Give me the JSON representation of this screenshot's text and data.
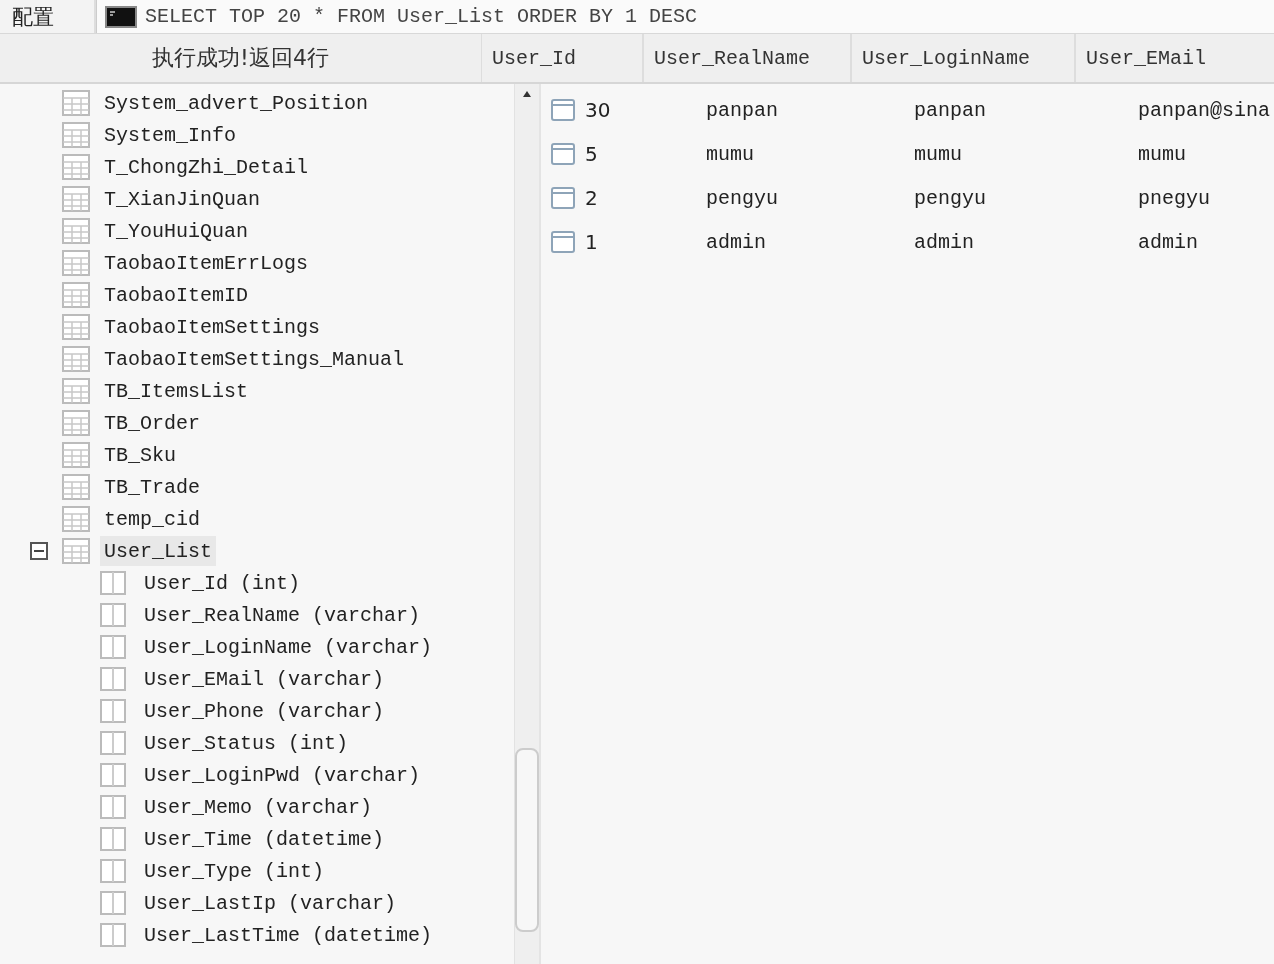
{
  "toolbar": {
    "config_label": "配置",
    "query": "SELECT TOP 20 * FROM User_List ORDER BY 1 DESC"
  },
  "status": "执行成功!返回4行",
  "tree": {
    "items": [
      {
        "label": "System_advert_Position",
        "selected": false
      },
      {
        "label": "System_Info",
        "selected": false
      },
      {
        "label": "T_ChongZhi_Detail",
        "selected": false
      },
      {
        "label": "T_XianJinQuan",
        "selected": false
      },
      {
        "label": "T_YouHuiQuan",
        "selected": false
      },
      {
        "label": "TaobaoItemErrLogs",
        "selected": false
      },
      {
        "label": "TaobaoItemID",
        "selected": false
      },
      {
        "label": "TaobaoItemSettings",
        "selected": false
      },
      {
        "label": "TaobaoItemSettings_Manual",
        "selected": false
      },
      {
        "label": "TB_ItemsList",
        "selected": false
      },
      {
        "label": "TB_Order",
        "selected": false
      },
      {
        "label": "TB_Sku",
        "selected": false
      },
      {
        "label": "TB_Trade",
        "selected": false
      },
      {
        "label": "temp_cid",
        "selected": false
      },
      {
        "label": "User_List",
        "selected": true,
        "expanded": true,
        "children": [
          {
            "label": "User_Id (int)"
          },
          {
            "label": "User_RealName (varchar)"
          },
          {
            "label": "User_LoginName (varchar)"
          },
          {
            "label": "User_EMail (varchar)"
          },
          {
            "label": "User_Phone (varchar)"
          },
          {
            "label": "User_Status (int)"
          },
          {
            "label": "User_LoginPwd (varchar)"
          },
          {
            "label": "User_Memo (varchar)"
          },
          {
            "label": "User_Time (datetime)"
          },
          {
            "label": "User_Type (int)"
          },
          {
            "label": "User_LastIp (varchar)"
          },
          {
            "label": "User_LastTime (datetime)"
          }
        ]
      }
    ]
  },
  "table": {
    "columns": [
      "User_Id",
      "User_RealName",
      "User_LoginName",
      "User_EMail"
    ],
    "rows": [
      [
        "30",
        "panpan",
        "panpan",
        "panpan@sina"
      ],
      [
        "5",
        "mumu",
        "mumu",
        "mumu"
      ],
      [
        "2",
        "pengyu",
        "pengyu",
        "pnegyu"
      ],
      [
        "1",
        "admin",
        "admin",
        "admin"
      ]
    ]
  }
}
